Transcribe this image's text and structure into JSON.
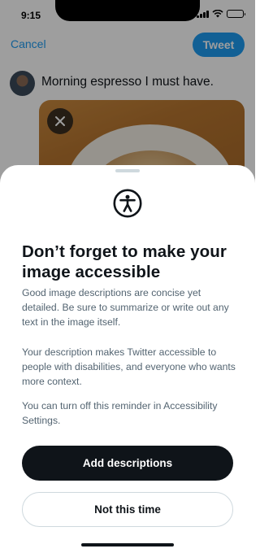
{
  "status_bar": {
    "time": "9:15"
  },
  "compose": {
    "cancel_label": "Cancel",
    "tweet_label": "Tweet",
    "tweet_text": "Morning espresso I must have."
  },
  "sheet": {
    "title": "Don’t forget to make your image accessible",
    "paragraphs": [
      "Good image descriptions are concise yet detailed. Be sure to summarize or write out any text in the image itself.",
      "Your description makes Twitter accessible to people with disabilities, and everyone who wants more context.",
      "You can turn off this reminder in Accessibility Settings."
    ],
    "primary_button": "Add descriptions",
    "secondary_button": "Not this time"
  },
  "colors": {
    "accent": "#1d9bf0",
    "text_primary": "#0f1419",
    "text_secondary": "#536471"
  }
}
